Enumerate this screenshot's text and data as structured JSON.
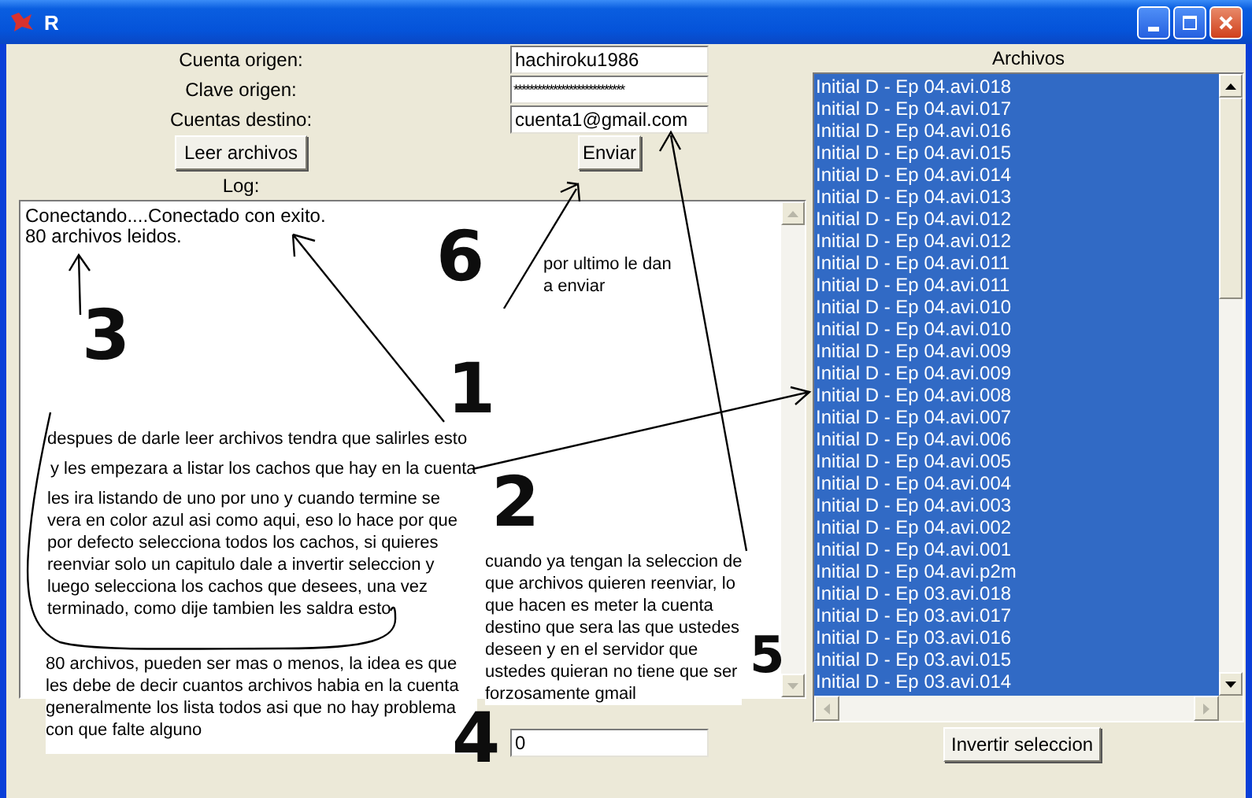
{
  "window": {
    "title": "R"
  },
  "form": {
    "fields": [
      {
        "label": "Cuenta origen:",
        "value": "hachiroku1986"
      },
      {
        "label": "Clave origen:",
        "value": "****************************",
        "kind": "password"
      },
      {
        "label": "Cuentas destino:",
        "value": "cuenta1@gmail.com"
      }
    ],
    "read_button": "Leer archivos",
    "send_button": "Enviar"
  },
  "log": {
    "label": "Log:",
    "lines": [
      "Conectando....Conectado con exito.",
      "80 archivos leidos."
    ]
  },
  "delay_field": {
    "value": "0"
  },
  "files": {
    "label": "Archivos",
    "items": [
      {
        "name": "Initial D - Ep 04.avi.018",
        "selected": true
      },
      {
        "name": "Initial D - Ep 04.avi.017",
        "selected": true
      },
      {
        "name": "Initial D - Ep 04.avi.016",
        "selected": true
      },
      {
        "name": "Initial D - Ep 04.avi.015",
        "selected": true
      },
      {
        "name": "Initial D - Ep 04.avi.014",
        "selected": true
      },
      {
        "name": "Initial D - Ep 04.avi.013",
        "selected": true
      },
      {
        "name": "Initial D - Ep 04.avi.012",
        "selected": true
      },
      {
        "name": "Initial D - Ep 04.avi.012",
        "selected": true
      },
      {
        "name": "Initial D - Ep 04.avi.011",
        "selected": true
      },
      {
        "name": "Initial D - Ep 04.avi.011",
        "selected": true
      },
      {
        "name": "Initial D - Ep 04.avi.010",
        "selected": true
      },
      {
        "name": "Initial D - Ep 04.avi.010",
        "selected": true
      },
      {
        "name": "Initial D - Ep 04.avi.009",
        "selected": true
      },
      {
        "name": "Initial D - Ep 04.avi.009",
        "selected": true
      },
      {
        "name": "Initial D - Ep 04.avi.008",
        "selected": true
      },
      {
        "name": "Initial D - Ep 04.avi.007",
        "selected": true
      },
      {
        "name": "Initial D - Ep 04.avi.006",
        "selected": true
      },
      {
        "name": "Initial D - Ep 04.avi.005",
        "selected": true
      },
      {
        "name": "Initial D - Ep 04.avi.004",
        "selected": true
      },
      {
        "name": "Initial D - Ep 04.avi.003",
        "selected": true
      },
      {
        "name": "Initial D - Ep 04.avi.002",
        "selected": true
      },
      {
        "name": "Initial D - Ep 04.avi.001",
        "selected": true
      },
      {
        "name": "Initial D - Ep 04.avi.p2m",
        "selected": true
      },
      {
        "name": "Initial D - Ep 03.avi.018",
        "selected": true
      },
      {
        "name": "Initial D - Ep 03.avi.017",
        "selected": true
      },
      {
        "name": "Initial D - Ep 03.avi.016",
        "selected": true
      },
      {
        "name": "Initial D - Ep 03.avi.015",
        "selected": true
      },
      {
        "name": "Initial D - Ep 03.avi.014",
        "selected": true
      }
    ],
    "invert_button": "Invertir seleccion"
  },
  "annotations": {
    "numbers": [
      {
        "text": "6"
      },
      {
        "text": "3"
      },
      {
        "text": "1"
      },
      {
        "text": "2"
      },
      {
        "text": "5"
      },
      {
        "text": "4"
      }
    ],
    "notes": [
      {
        "text": "por ultimo le dan\na enviar"
      },
      {
        "text": "despues de darle leer archivos tendra que salirles esto"
      },
      {
        "text": "y les empezara a listar los cachos que hay en la cuenta"
      },
      {
        "text": "les ira listando de uno por uno y cuando termine se\nvera en color azul asi como aqui, eso lo hace por que\npor defecto selecciona todos los cachos, si quieres\nreenviar solo un capitulo dale a invertir seleccion y\nluego selecciona los cachos que desees, una vez\nterminado, como dije tambien les saldra esto"
      },
      {
        "text": "cuando ya tengan la seleccion de\nque archivos quieren reenviar, lo\nque hacen es meter la cuenta\ndestino que sera las que ustedes\ndeseen y en el servidor que\nustedes quieran no tiene que ser\nforzosamente gmail"
      },
      {
        "text": "80 archivos, pueden ser mas o menos, la idea es que\nles debe de decir cuantos archivos habia en la cuenta\ngeneralmente los lista todos asi que no hay problema\ncon que falte alguno"
      }
    ]
  }
}
